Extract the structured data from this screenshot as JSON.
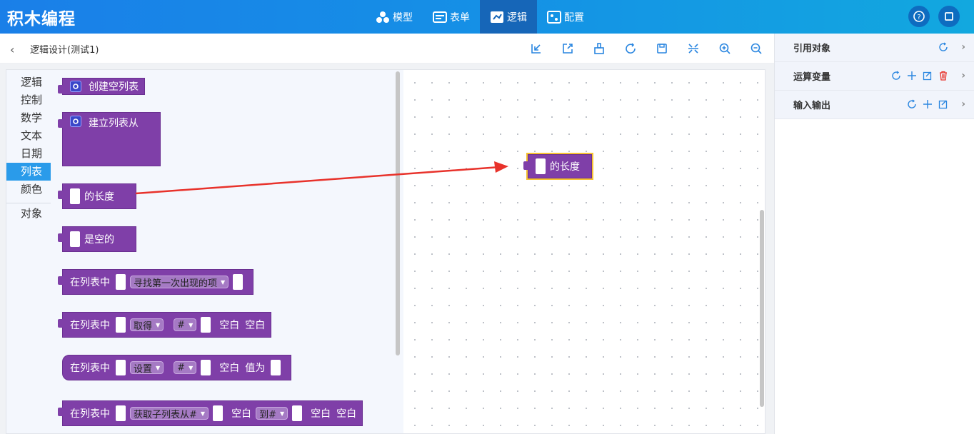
{
  "app": {
    "title": "积木编程"
  },
  "nav": [
    {
      "label": "模型",
      "icon": "model-icon"
    },
    {
      "label": "表单",
      "icon": "form-icon"
    },
    {
      "label": "逻辑",
      "icon": "logic-icon",
      "active": true
    },
    {
      "label": "配置",
      "icon": "config-icon"
    }
  ],
  "subheader": {
    "breadcrumb": "逻辑设计(测试1)"
  },
  "categories": [
    "逻辑",
    "控制",
    "数学",
    "文本",
    "日期",
    "列表",
    "颜色",
    "对象"
  ],
  "active_category": "列表",
  "blocks": {
    "create_empty": "创建空列表",
    "create_from": "建立列表从",
    "length_of": "的长度",
    "is_empty": "是空的",
    "in_list": "在列表中",
    "find_first": "寻找第一次出现的项",
    "get": "取得",
    "hash": "#",
    "empty": "空白",
    "set": "设置",
    "value_as": "值为",
    "get_sublist": "获取子列表从#",
    "to_hash": "到#"
  },
  "canvas_block": {
    "label": "的长度"
  },
  "right_panel": {
    "rows": [
      {
        "label": "引用对象"
      },
      {
        "label": "运算变量"
      },
      {
        "label": "输入输出"
      }
    ]
  },
  "colors": {
    "block": "#7f3fa8",
    "accent": "#2a9bea",
    "arrow": "#e8322b",
    "selection": "#f6c232"
  }
}
